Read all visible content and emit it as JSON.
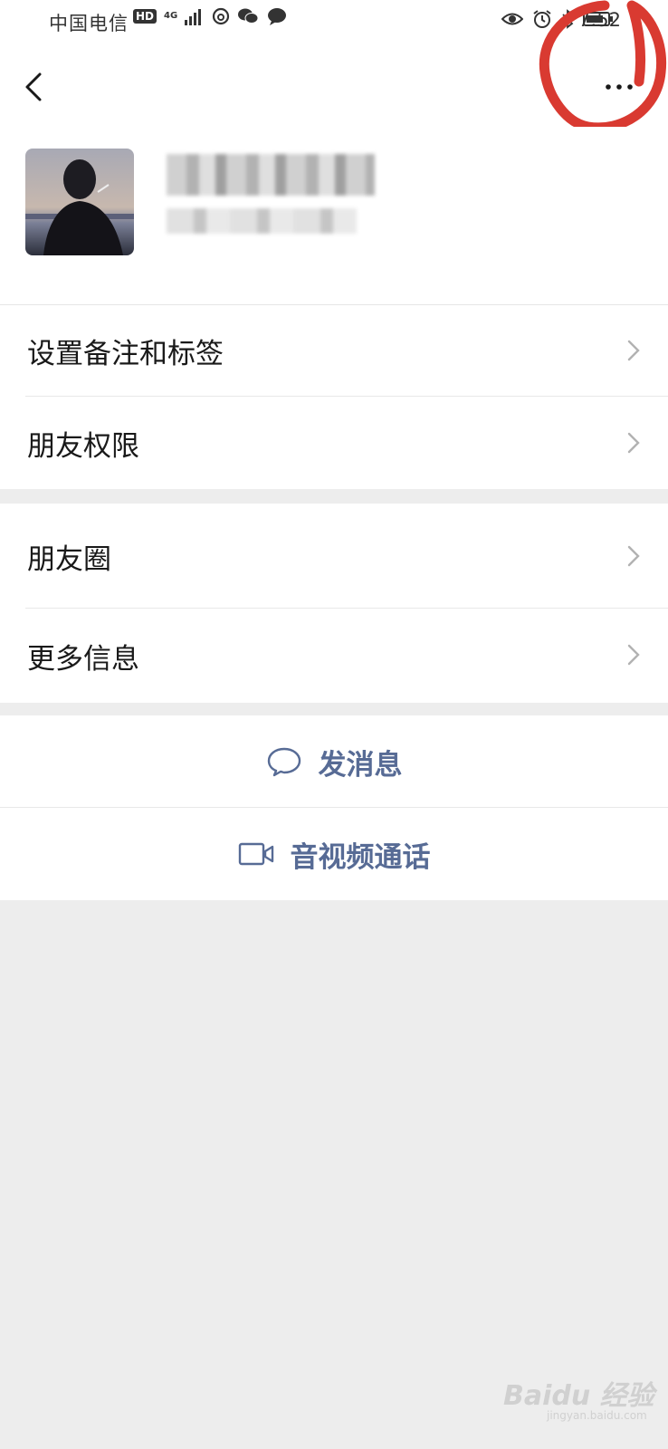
{
  "status_bar": {
    "carrier": "中国电信",
    "hd_badge": "HD",
    "network": "4G",
    "time": "7:52"
  },
  "nav": {
    "back_icon": "chevron-left-icon",
    "more_icon": "ellipsis-icon"
  },
  "profile": {
    "avatar": "avatar",
    "name": "",
    "wechat_id": ""
  },
  "menu_group_1": [
    {
      "label": "设置备注和标签"
    },
    {
      "label": "朋友权限"
    }
  ],
  "menu_group_2": [
    {
      "label": "朋友圈"
    },
    {
      "label": "更多信息"
    }
  ],
  "actions": [
    {
      "label": "发消息",
      "icon": "chat-bubble-icon"
    },
    {
      "label": "音视频通话",
      "icon": "video-camera-icon"
    }
  ],
  "watermark": {
    "logo_text": "Baidu 经验",
    "url": "jingyan.baidu.com"
  },
  "colors": {
    "link_blue": "#576b95",
    "background": "#ededed",
    "annotation_red": "#d93a31"
  }
}
